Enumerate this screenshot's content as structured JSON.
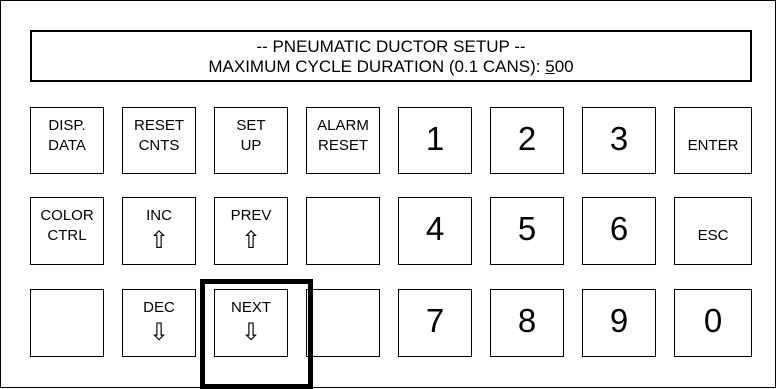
{
  "display": {
    "title": "-- PNEUMATIC DUCTOR SETUP --",
    "prompt": "MAXIMUM CYCLE DURATION (0.1 CANS): ",
    "value_cursor_digit": "5",
    "value_rest": "00"
  },
  "keys": {
    "disp_data": "DISP.\nDATA",
    "reset_cnts": "RESET\nCNTS",
    "set_up": "SET\nUP",
    "alarm_reset": "ALARM\nRESET",
    "color_ctrl": "COLOR\nCTRL",
    "inc": "INC",
    "prev": "PREV",
    "dec": "DEC",
    "next": "NEXT",
    "enter": "ENTER",
    "esc": "ESC",
    "d1": "1",
    "d2": "2",
    "d3": "3",
    "d4": "4",
    "d5": "5",
    "d6": "6",
    "d7": "7",
    "d8": "8",
    "d9": "9",
    "d0": "0"
  },
  "icons": {
    "up_arrow": "⇧",
    "down_arrow": "⇩"
  }
}
